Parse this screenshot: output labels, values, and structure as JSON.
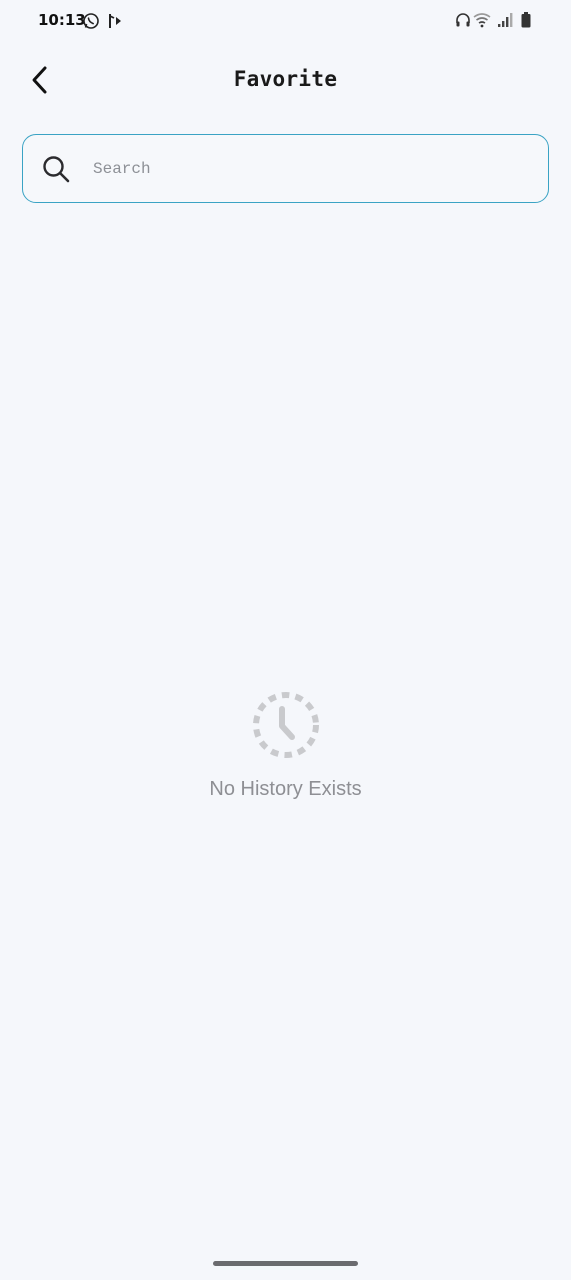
{
  "status_bar": {
    "time": "10:13",
    "icons_left": [
      "whatsapp-icon",
      "bluetooth-share-icon"
    ],
    "icons_right": [
      "headphones-icon",
      "wifi-icon",
      "signal-icon",
      "battery-icon"
    ]
  },
  "app_bar": {
    "back_icon": "chevron-left-icon",
    "title": "Favorite"
  },
  "search": {
    "icon": "search-icon",
    "placeholder": "Search",
    "value": "",
    "border_color": "#3aa3c4"
  },
  "empty_state": {
    "icon": "dashed-clock-icon",
    "message": "No History Exists"
  },
  "colors": {
    "background": "#f5f7fb",
    "muted_text": "#8e8f94",
    "accent": "#3aa3c4"
  }
}
